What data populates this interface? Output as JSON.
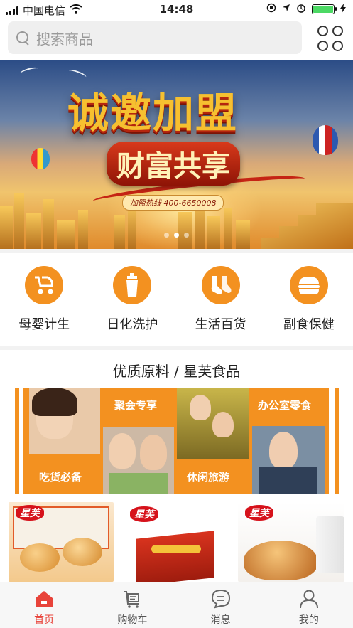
{
  "status_bar": {
    "carrier": "中国电信",
    "time": "14:48"
  },
  "search": {
    "placeholder": "搜索商品"
  },
  "banner": {
    "headline": "诚邀加盟",
    "subheadline": "财富共享",
    "hotline": "加盟热线 400-6650008",
    "slide_count": 3,
    "active_slide": 2
  },
  "categories": [
    {
      "label": "母婴计生",
      "icon": "stroller-icon"
    },
    {
      "label": "日化洗护",
      "icon": "lotion-bottle-icon"
    },
    {
      "label": "生活百货",
      "icon": "socks-icon"
    },
    {
      "label": "副食保健",
      "icon": "burger-icon"
    }
  ],
  "featured": {
    "title": "优质原料 / 星芙食品",
    "tags": [
      "吃货必备",
      "聚会专享",
      "休闲旅游",
      "办公室零食"
    ]
  },
  "products": {
    "brand": "星芙"
  },
  "tabbar": {
    "items": [
      {
        "label": "首页",
        "icon": "home-icon",
        "active": true
      },
      {
        "label": "购物车",
        "icon": "cart-icon",
        "active": false
      },
      {
        "label": "消息",
        "icon": "message-icon",
        "active": false
      },
      {
        "label": "我的",
        "icon": "user-icon",
        "active": false
      }
    ]
  },
  "colors": {
    "accent_orange": "#f39120",
    "tab_active": "#e8433a",
    "brand_red": "#d6121b"
  }
}
